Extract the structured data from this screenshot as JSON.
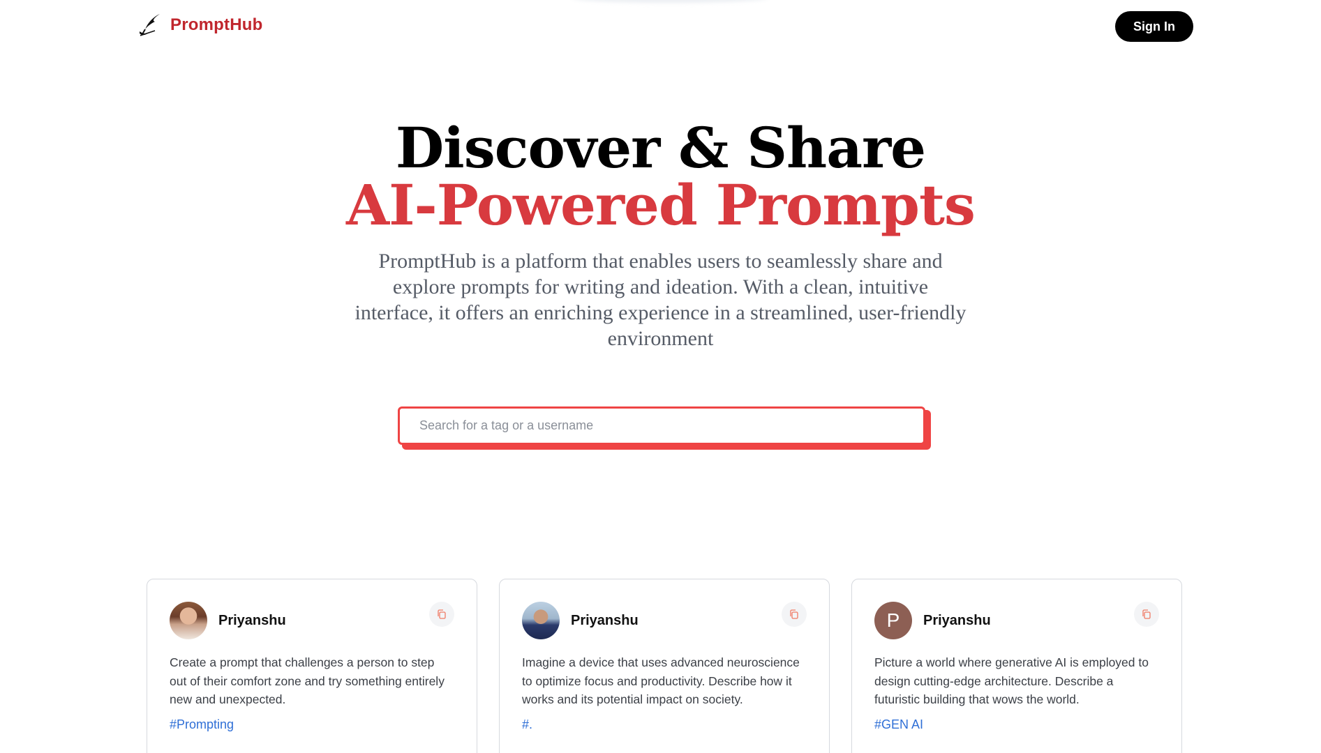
{
  "nav": {
    "brand_name": "PromptHub",
    "logo_icon": "quill-icon",
    "signin_label": "Sign In"
  },
  "hero": {
    "line1": "Discover & Share",
    "line2": "AI-Powered Prompts",
    "description": "PromptHub is a platform that enables users to seamlessly share and explore prompts for writing and ideation. With a clean, intuitive interface, it offers an enriching experience in a streamlined, user-friendly environment"
  },
  "search": {
    "placeholder": "Search for a tag or a username",
    "value": ""
  },
  "colors": {
    "brand": "#c0262d",
    "accent": "#d83a3f",
    "search_border": "#ef4444",
    "tag": "#2f6fd6"
  },
  "cards": [
    {
      "username": "Priyanshu",
      "avatar_initial": "",
      "prompt": "Create a prompt that challenges a person to step out of their comfort zone and try something entirely new and unexpected.",
      "tag": "#Prompting",
      "copy_icon": "copy-icon"
    },
    {
      "username": "Priyanshu",
      "avatar_initial": "",
      "prompt": "Imagine a device that uses advanced neuroscience to optimize focus and productivity. Describe how it works and its potential impact on society.",
      "tag": "#.",
      "copy_icon": "copy-icon"
    },
    {
      "username": "Priyanshu",
      "avatar_initial": "P",
      "prompt": "Picture a world where generative AI is employed to design cutting-edge architecture. Describe a futuristic building that wows the world.",
      "tag": "#GEN AI",
      "copy_icon": "copy-icon"
    }
  ]
}
